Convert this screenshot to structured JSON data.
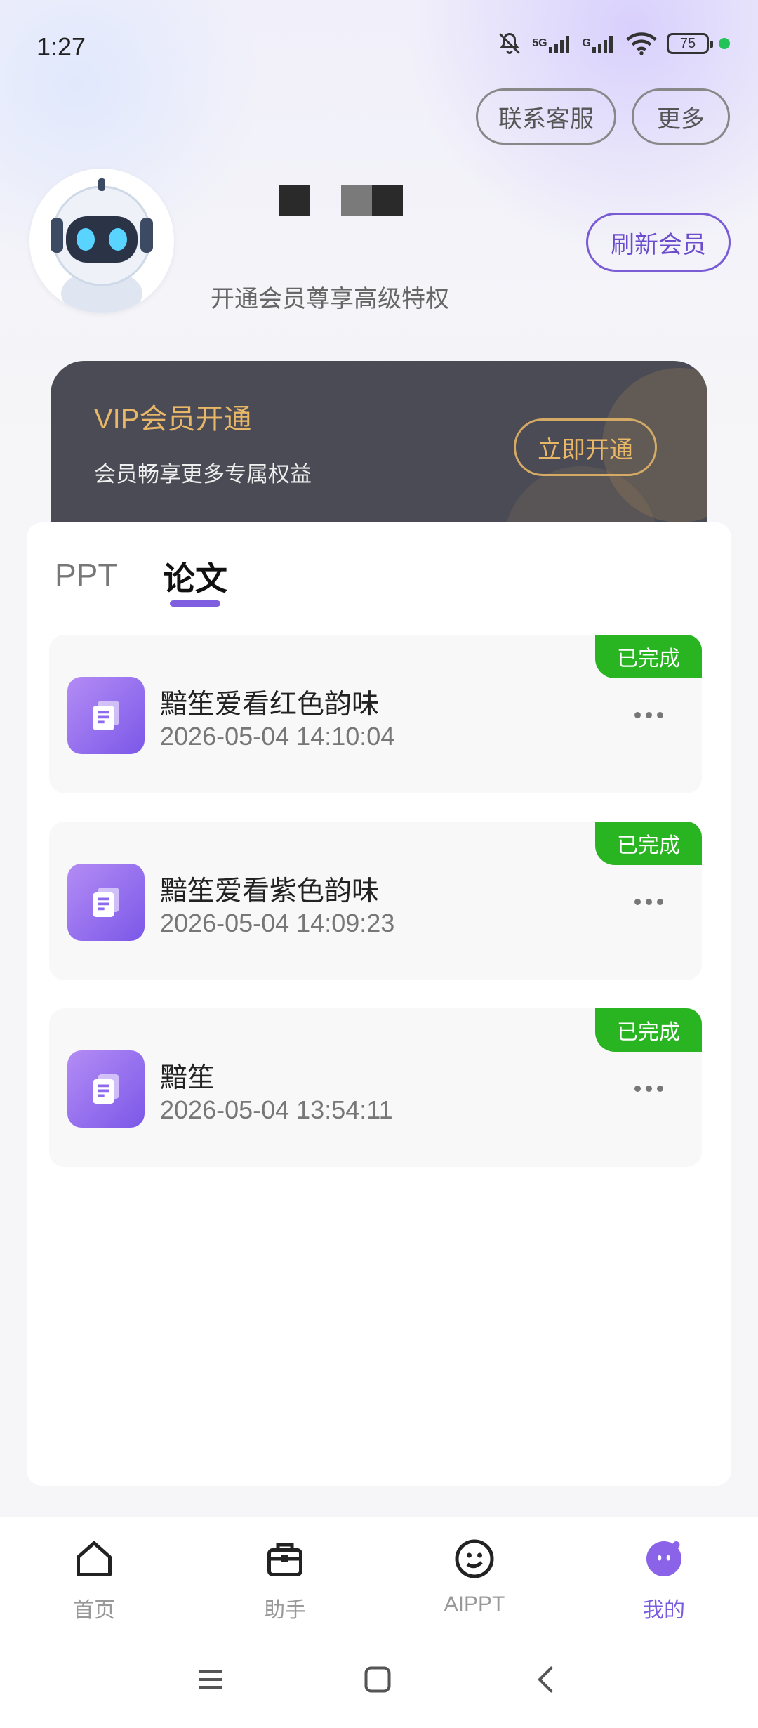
{
  "status_bar": {
    "time": "1:27",
    "signal_5g": "5G",
    "signal_g": "G",
    "battery": "75"
  },
  "top_actions": {
    "contact_label": "联系客服",
    "more_label": "更多"
  },
  "profile": {
    "subtitle": "开通会员尊享高级特权",
    "refresh_label": "刷新会员"
  },
  "vip": {
    "title": "VIP会员开通",
    "description": "会员畅享更多专属权益",
    "open_label": "立即开通"
  },
  "tabs": [
    {
      "label": "PPT",
      "active": false
    },
    {
      "label": "论文",
      "active": true
    }
  ],
  "records": [
    {
      "title": "黯笙爱看红色韵味",
      "time": "2026-05-04 14:10:04",
      "status": "已完成"
    },
    {
      "title": "黯笙爱看紫色韵味",
      "time": "2026-05-04 14:09:23",
      "status": "已完成"
    },
    {
      "title": "黯笙",
      "time": "2026-05-04 13:54:11",
      "status": "已完成"
    }
  ],
  "bottom_nav": [
    {
      "label": "首页",
      "icon": "home-icon",
      "active": false
    },
    {
      "label": "助手",
      "icon": "toolbox-icon",
      "active": false
    },
    {
      "label": "AIPPT",
      "icon": "smiley-icon",
      "active": false
    },
    {
      "label": "我的",
      "icon": "profile-icon",
      "active": true
    }
  ],
  "colors": {
    "accent": "#7a5ce0",
    "vip_gold": "#e8b767",
    "badge_green": "#28b521",
    "vip_bg": "#4b4b55"
  }
}
